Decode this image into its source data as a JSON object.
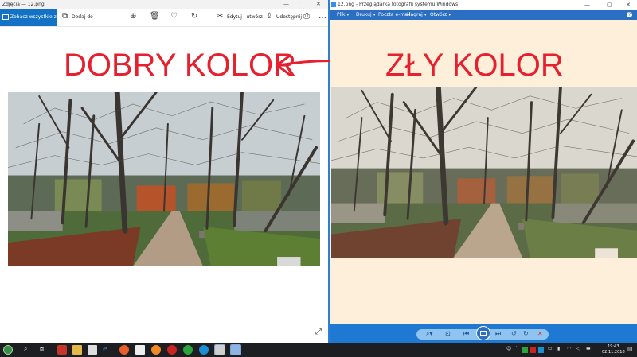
{
  "left_window": {
    "title": "Zdjęcia — 12.png",
    "toolbar": {
      "see_all": "Zobacz wszystkie zdjęcia",
      "add_to": "Dodaj do",
      "edit_create": "Edytuj i utwórz",
      "share": "Udostępnij"
    },
    "label": "DOBRY KOLOR"
  },
  "right_window": {
    "title": "12.png - Przeglądarka fotografii systemu Windows",
    "menu": [
      "Plik",
      "Drukuj",
      "Poczta e-mail",
      "Nagraj",
      "Otwórz"
    ],
    "label": "ZŁY KOLOR"
  },
  "taskbar": {
    "time": "19:43",
    "date": "02.11.2018"
  },
  "colors": {
    "label_red": "#e5212f",
    "accent_blue": "#1472c4",
    "viewer_bg": "#fdefd9"
  }
}
